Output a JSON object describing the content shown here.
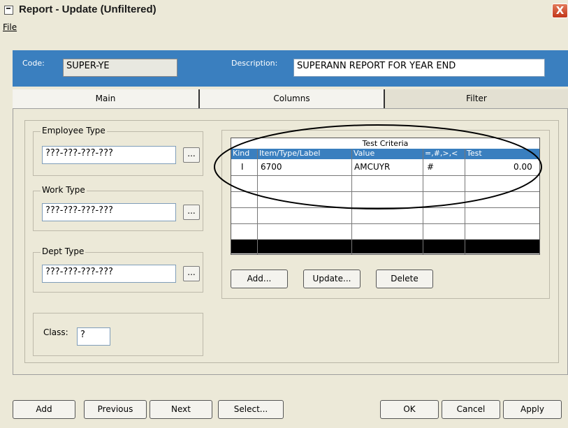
{
  "window": {
    "title": "Report - Update (Unfiltered)",
    "close_glyph": "X"
  },
  "menu": {
    "file_label": "File"
  },
  "header": {
    "code_label": "Code:",
    "code_value": "SUPER-YE",
    "description_label": "Description:",
    "description_value": "SUPERANN REPORT FOR YEAR END"
  },
  "tabs": [
    {
      "label": "Main"
    },
    {
      "label": "Columns"
    },
    {
      "label": "Filter"
    }
  ],
  "filter": {
    "employee_type": {
      "label": "Employee Type",
      "value": "???-???-???-???"
    },
    "work_type": {
      "label": "Work Type",
      "value": "???-???-???-???"
    },
    "dept_type": {
      "label": "Dept Type",
      "value": "???-???-???-???"
    },
    "class": {
      "label": "Class:",
      "value": "?"
    },
    "dots_label": "...",
    "grid": {
      "title": "Test Criteria",
      "columns": [
        "Kind",
        "Item/Type/Label",
        "Value",
        "=,#,>,<",
        "Test"
      ],
      "rows": [
        [
          "I",
          "6700",
          "AMCUYR",
          "#",
          "0.00"
        ]
      ]
    },
    "buttons": {
      "add": "Add...",
      "update": "Update...",
      "delete": "Delete"
    }
  },
  "footer": {
    "add": "Add",
    "previous": "Previous",
    "next": "Next",
    "select": "Select...",
    "ok": "OK",
    "cancel": "Cancel",
    "apply": "Apply"
  },
  "colors": {
    "header_blue": "#3a7fbf",
    "selected_row": "#000000",
    "grid_header": "#3a7fbf"
  }
}
